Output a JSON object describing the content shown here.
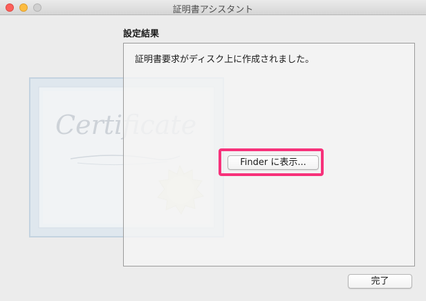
{
  "window": {
    "title": "証明書アシスタント"
  },
  "section": {
    "heading": "設定結果"
  },
  "content": {
    "message": "証明書要求がディスク上に作成されました。",
    "finder_button_label": "Finder に表示..."
  },
  "footer": {
    "done_label": "完了"
  },
  "certificate_art": {
    "text": "Certificate"
  },
  "colors": {
    "highlight": "#f7317a",
    "close": "#fc605b",
    "minimize": "#fdbc40",
    "zoom": "#d0d0d0"
  }
}
